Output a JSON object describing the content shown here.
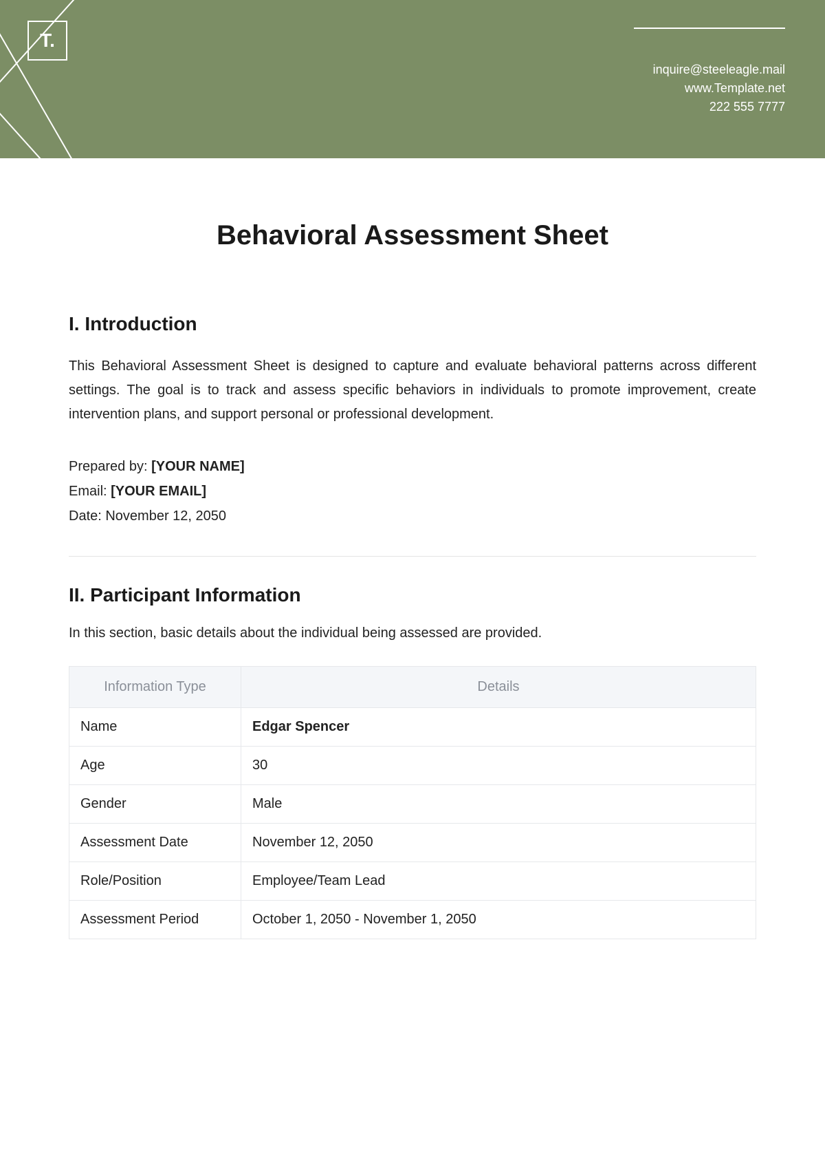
{
  "header": {
    "logo_text": "T.",
    "contact_email": "inquire@steeleagle.mail",
    "website": "www.Template.net",
    "phone": "222 555 7777"
  },
  "document": {
    "title": "Behavioral Assessment Sheet"
  },
  "section1": {
    "heading": "I. Introduction",
    "body": "This Behavioral Assessment Sheet is designed to capture and evaluate behavioral patterns across different settings. The goal is to track and assess specific behaviors in individuals to promote improvement, create intervention plans, and support personal or professional development.",
    "prepared_by_label": "Prepared by: ",
    "prepared_by_value": "[YOUR NAME]",
    "email_label": "Email: ",
    "email_value": "[YOUR EMAIL]",
    "date_label": "Date: ",
    "date_value": "November 12, 2050"
  },
  "section2": {
    "heading": "II. Participant Information",
    "desc": "In this section, basic details about the individual being assessed are provided.",
    "col1": "Information Type",
    "col2": "Details",
    "rows": [
      {
        "label": "Name",
        "value": "Edgar Spencer",
        "bold": true
      },
      {
        "label": "Age",
        "value": "30",
        "bold": false
      },
      {
        "label": "Gender",
        "value": "Male",
        "bold": false
      },
      {
        "label": "Assessment Date",
        "value": "November 12, 2050",
        "bold": false
      },
      {
        "label": "Role/Position",
        "value": "Employee/Team Lead",
        "bold": false
      },
      {
        "label": "Assessment Period",
        "value": "October 1, 2050 - November 1, 2050",
        "bold": false
      }
    ]
  }
}
